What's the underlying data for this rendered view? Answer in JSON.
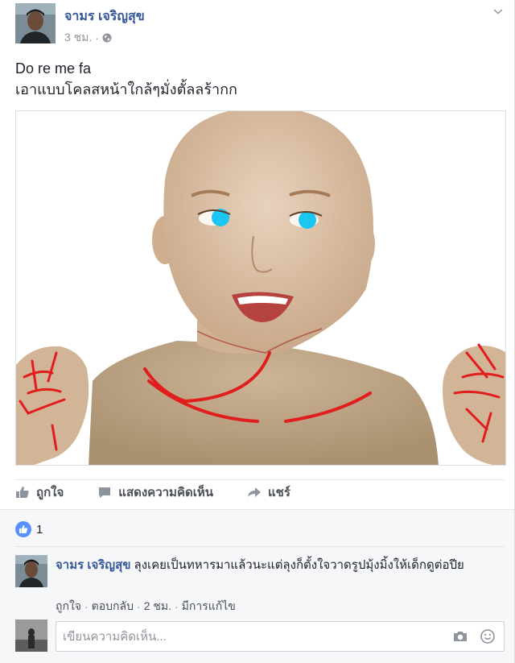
{
  "post": {
    "author": "จามร เจริญสุข",
    "time": "3 ชม.",
    "separator": "·",
    "text_line1": "Do re me fa",
    "text_line2": "เอาแบบโคลสหน้าใกล้ๆมั่งตั้ลลร้ากก"
  },
  "actions": {
    "like": "ถูกใจ",
    "comment": "แสดงความคิดเห็น",
    "share": "แชร์"
  },
  "reactions": {
    "count": "1"
  },
  "comment": {
    "author": "จามร เจริญสุข",
    "text": "ลุงเคยเป็นทหารมาแล้วนะแต่ลุงก็ตั้งใจวาดรูปมุ้งมิ้งให้เด็กดูต่อปีย",
    "like": "ถูกใจ",
    "reply": "ตอบกลับ",
    "time": "2 ชม.",
    "edited": "มีการแก้ไข",
    "dot": "·"
  },
  "composer": {
    "placeholder": "เขียนความคิดเห็น..."
  },
  "colors": {
    "link": "#365899",
    "like_blue": "#5890ff",
    "skin": "#d8bc9e",
    "eye": "#1cc6f2",
    "marker_red": "#e11d1d"
  }
}
